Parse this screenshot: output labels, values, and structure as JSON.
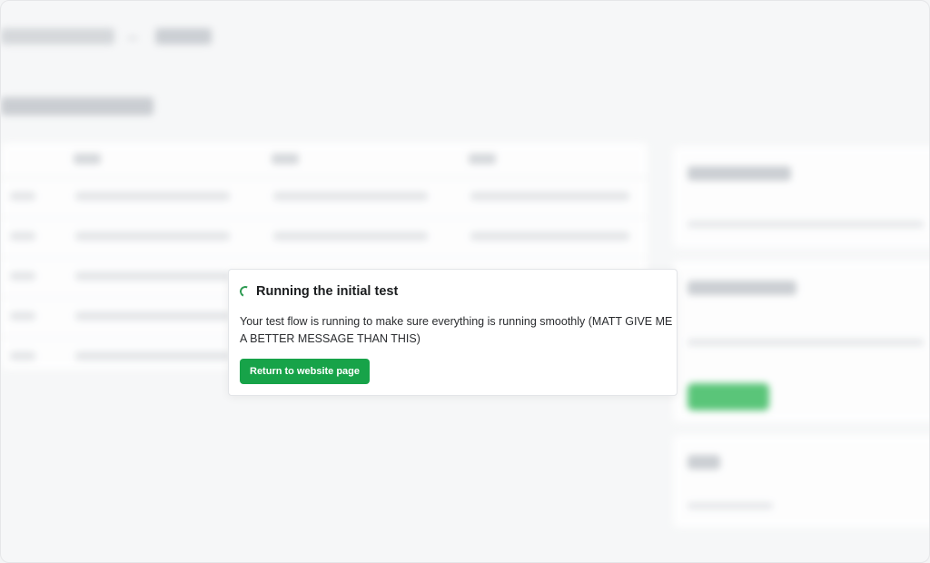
{
  "modal": {
    "title": "Running the initial test",
    "message": "Your test flow is running to make sure everything is running smoothly (MATT GIVE ME A BETTER MESSAGE THAN THIS)",
    "button_label": "Return to website page",
    "spinner_icon": "loading-spinner-icon",
    "accent_color": "#17a349"
  },
  "background": {
    "blurred": true
  }
}
